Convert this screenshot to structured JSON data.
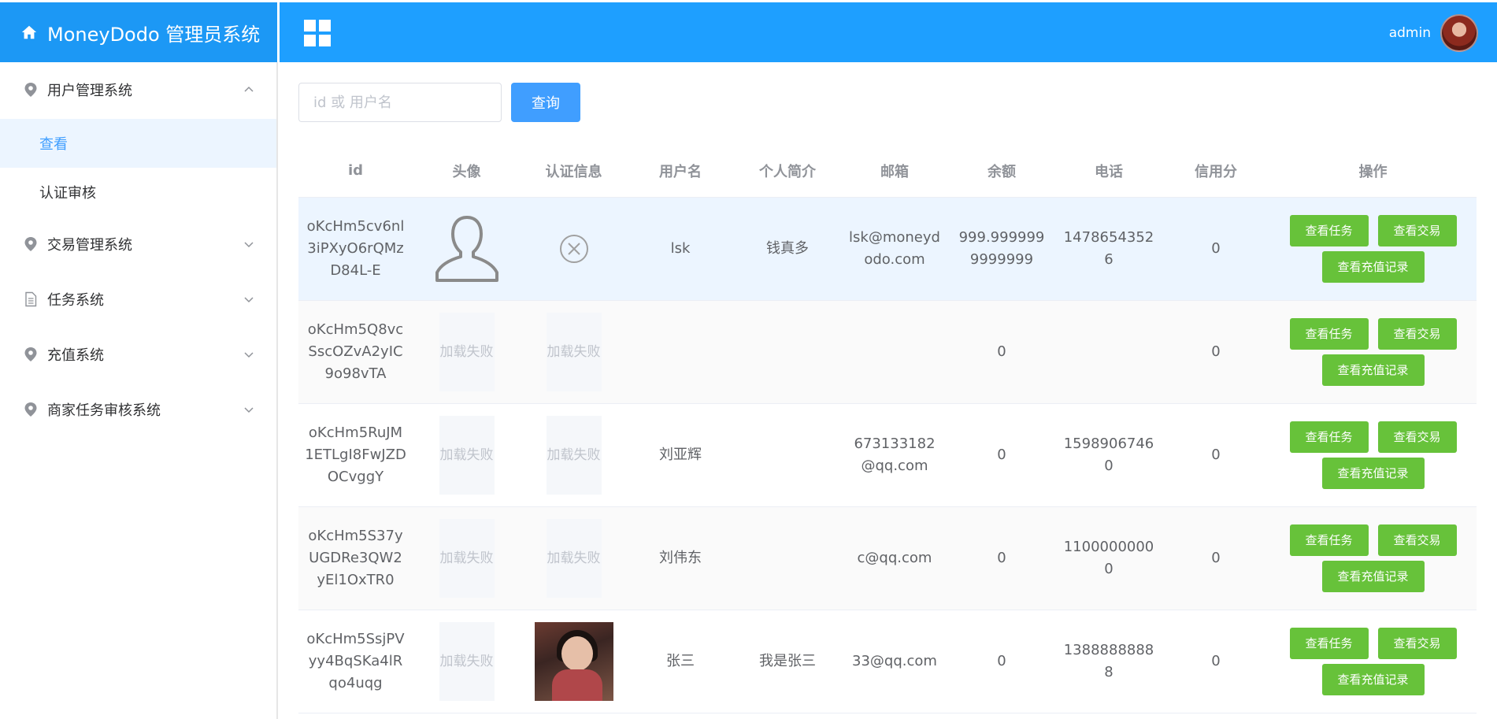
{
  "app": {
    "title": "MoneyDodo 管理员系统"
  },
  "header": {
    "username": "admin"
  },
  "sidebar": {
    "groups": [
      {
        "label": "用户管理系统",
        "icon": "location-pin-icon",
        "expanded": true,
        "items": [
          {
            "label": "查看",
            "active": true
          },
          {
            "label": "认证审核",
            "active": false
          }
        ]
      },
      {
        "label": "交易管理系统",
        "icon": "location-pin-icon",
        "expanded": false
      },
      {
        "label": "任务系统",
        "icon": "document-icon",
        "expanded": false
      },
      {
        "label": "充值系统",
        "icon": "location-pin-icon",
        "expanded": false
      },
      {
        "label": "商家任务审核系统",
        "icon": "location-pin-icon",
        "expanded": false
      }
    ]
  },
  "search": {
    "placeholder": "id 或 用户名",
    "button": "查询"
  },
  "table": {
    "columns": [
      "id",
      "头像",
      "认证信息",
      "用户名",
      "个人简介",
      "邮箱",
      "余额",
      "电话",
      "信用分",
      "操作"
    ],
    "load_fail": "加载失败",
    "actions": {
      "tasks": "查看任务",
      "trades": "查看交易",
      "recharge": "查看充值记录"
    },
    "rows": [
      {
        "id": "oKcHm5cv6nl3iPXyO6rQMzD84L-E",
        "avatar": "default-user-icon",
        "auth": "x-circle-icon",
        "username": "lsk",
        "bio": "钱真多",
        "email": "lsk@moneydodo.com",
        "balance": "999.9999999999999",
        "phone": "14786543526",
        "credit": "0"
      },
      {
        "id": "oKcHm5Q8vcSscOZvA2yIC9o98vTA",
        "avatar": "load-fail",
        "auth": "load-fail",
        "username": "",
        "bio": "",
        "email": "",
        "balance": "0",
        "phone": "",
        "credit": "0"
      },
      {
        "id": "oKcHm5RuJM1ETLgI8FwJZDOCvggY",
        "avatar": "load-fail",
        "auth": "load-fail",
        "username": "刘亚辉",
        "bio": "",
        "email": "673133182@qq.com",
        "balance": "0",
        "phone": "15989067460",
        "credit": "0"
      },
      {
        "id": "oKcHm5S37yUGDRe3QW2yEl1OxTR0",
        "avatar": "load-fail",
        "auth": "load-fail",
        "username": "刘伟东",
        "bio": "",
        "email": "c@qq.com",
        "balance": "0",
        "phone": "11000000000",
        "credit": "0"
      },
      {
        "id": "oKcHm5SsjPVyy4BqSKa4lRqo4uqg",
        "avatar": "load-fail",
        "auth": "photo",
        "username": "张三",
        "bio": "我是张三",
        "email": "33@qq.com",
        "balance": "0",
        "phone": "13888888888",
        "credit": "0"
      }
    ]
  },
  "colors": {
    "header": "#1E9FFF",
    "primary": "#409EFF",
    "success": "#67C23A",
    "active_bg": "#ecf5ff"
  }
}
